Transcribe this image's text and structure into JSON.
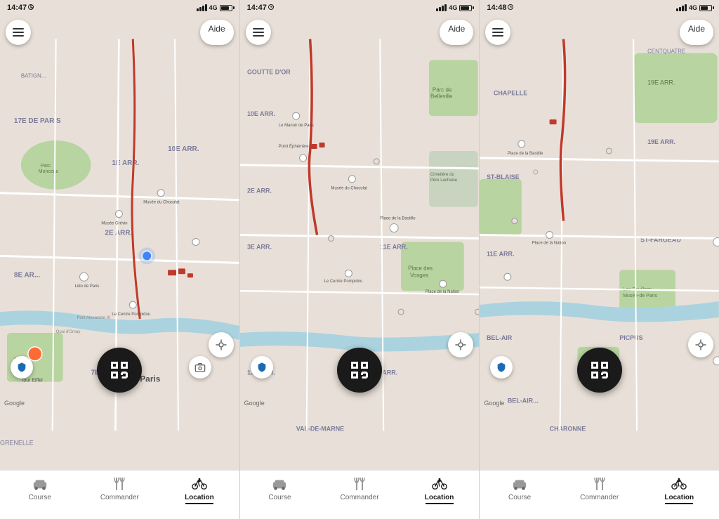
{
  "screens": [
    {
      "id": "screen-1",
      "statusBar": {
        "time": "14:47",
        "signal": "4G",
        "batteryLevel": 80
      },
      "controls": {
        "aideLabel": "Aide"
      },
      "tabs": [
        {
          "id": "course",
          "label": "Course",
          "icon": "car",
          "active": false
        },
        {
          "id": "commander",
          "label": "Commander",
          "icon": "fork",
          "active": false
        },
        {
          "id": "location",
          "label": "Location",
          "icon": "bike",
          "active": true
        }
      ],
      "googleLogo": "Google"
    },
    {
      "id": "screen-2",
      "statusBar": {
        "time": "14:47",
        "signal": "4G",
        "batteryLevel": 80
      },
      "controls": {
        "aideLabel": "Aide"
      },
      "tabs": [
        {
          "id": "course",
          "label": "Course",
          "icon": "car",
          "active": false
        },
        {
          "id": "commander",
          "label": "Commander",
          "icon": "fork",
          "active": false
        },
        {
          "id": "location",
          "label": "Location",
          "icon": "bike",
          "active": true
        }
      ],
      "googleLogo": "Google"
    },
    {
      "id": "screen-3",
      "statusBar": {
        "time": "14:48",
        "signal": "4G",
        "batteryLevel": 75
      },
      "controls": {
        "aideLabel": "Aide"
      },
      "tabs": [
        {
          "id": "course",
          "label": "Course",
          "icon": "car",
          "active": false
        },
        {
          "id": "commander",
          "label": "Commander",
          "icon": "fork",
          "active": false
        },
        {
          "id": "location",
          "label": "Location",
          "icon": "bike",
          "active": true
        }
      ],
      "googleLogo": "Google"
    }
  ]
}
